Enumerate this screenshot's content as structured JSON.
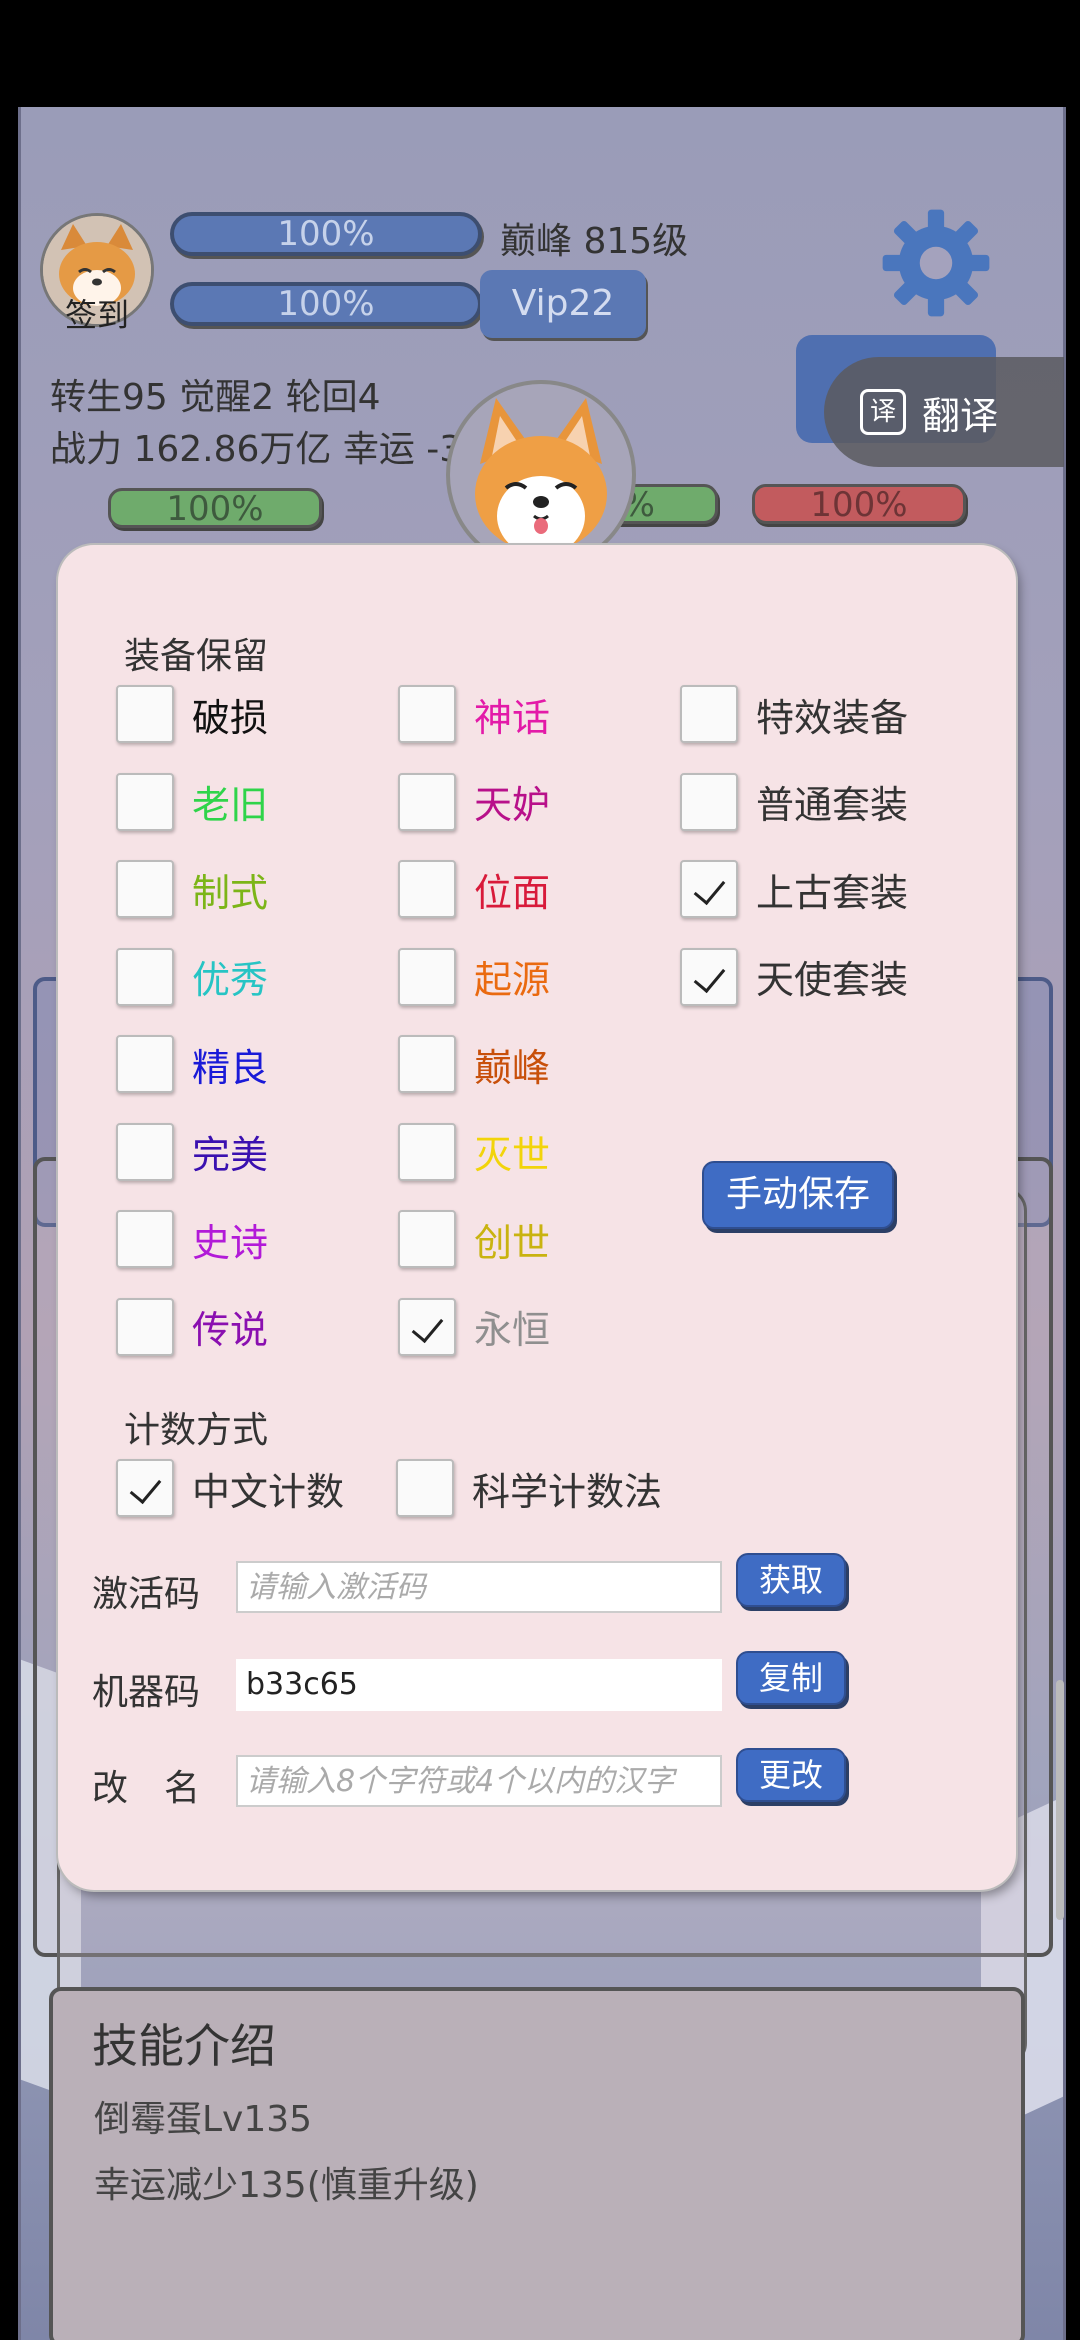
{
  "header": {
    "signin_label": "签到",
    "bar1_percent": "100%",
    "bar2_percent": "100%",
    "level_text": "巅峰 815级",
    "vip_label": "Vip22",
    "translate_label": "翻译",
    "translate_icon": "译",
    "line1": "转生95 觉醒2 轮回4",
    "line2": "战力 162.86万亿  幸运 -3",
    "hp_left": "100%",
    "hp_mid": "0%",
    "hp_right": "100%"
  },
  "dialog": {
    "equip_title": "装备保留",
    "equip_options": [
      {
        "label": "破损",
        "color": "#111111",
        "checked": false
      },
      {
        "label": "老旧",
        "color": "#2fd44a",
        "checked": false
      },
      {
        "label": "制式",
        "color": "#7cb518",
        "checked": false
      },
      {
        "label": "优秀",
        "color": "#27c4c4",
        "checked": false
      },
      {
        "label": "精良",
        "color": "#1a1ad8",
        "checked": false
      },
      {
        "label": "完美",
        "color": "#3a10b0",
        "checked": false
      },
      {
        "label": "史诗",
        "color": "#b21ad8",
        "checked": false
      },
      {
        "label": "传说",
        "color": "#8a0fb0",
        "checked": false
      },
      {
        "label": "神话",
        "color": "#e31aa8",
        "checked": false
      },
      {
        "label": "天妒",
        "color": "#b8108a",
        "checked": false
      },
      {
        "label": "位面",
        "color": "#d81a3a",
        "checked": false
      },
      {
        "label": "起源",
        "color": "#ea6a10",
        "checked": false
      },
      {
        "label": "巅峰",
        "color": "#c8500a",
        "checked": false
      },
      {
        "label": "灭世",
        "color": "#f2d40a",
        "checked": false
      },
      {
        "label": "创世",
        "color": "#c9b310",
        "checked": false
      },
      {
        "label": "永恒",
        "color": "#8f8f8f",
        "checked": true
      },
      {
        "label": "特效装备",
        "color": "#333333",
        "checked": false
      },
      {
        "label": "普通套装",
        "color": "#333333",
        "checked": false
      },
      {
        "label": "上古套装",
        "color": "#333333",
        "checked": true
      },
      {
        "label": "天使套装",
        "color": "#333333",
        "checked": true
      }
    ],
    "save_button": "手动保存",
    "count_title": "计数方式",
    "count_options": [
      {
        "label": "中文计数",
        "checked": true
      },
      {
        "label": "科学计数法",
        "checked": false
      }
    ],
    "activation": {
      "label": "激活码",
      "placeholder": "请输入激活码",
      "value": "",
      "button": "获取"
    },
    "machine": {
      "label": "机器码",
      "value": "b33c65",
      "button": "复制"
    },
    "rename": {
      "label": "改　名",
      "placeholder": "请输入8个字符或4个以内的汉字",
      "value": "",
      "button": "更改"
    }
  },
  "skill": {
    "title": "技能介绍",
    "name": "倒霉蛋Lv135",
    "desc": "幸运减少135(慎重升级)"
  },
  "colors": {
    "accent": "#3f6cc4",
    "dialog_bg": "#f6e3e6",
    "bar_blue": "#5b78b4"
  }
}
